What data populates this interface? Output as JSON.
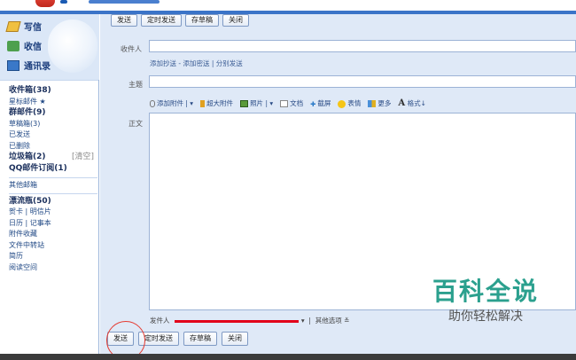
{
  "sidebar": {
    "compose_label": "写信",
    "inbox_label": "收信",
    "contacts_label": "通讯录",
    "folders": [
      {
        "label": "收件箱(38)",
        "bold": true
      },
      {
        "label": "星标邮件 ★",
        "bold": false
      },
      {
        "label": "群邮件(9)",
        "bold": true
      },
      {
        "label": "草稿箱(3)",
        "bold": false
      },
      {
        "label": "已发送",
        "bold": false
      },
      {
        "label": "已删除",
        "bold": false
      },
      {
        "label": "垃圾箱(2)",
        "bold": true,
        "extra": "[清空]"
      },
      {
        "label": "QQ邮件订阅(1)",
        "bold": true
      },
      {
        "label": "其他邮箱",
        "bold": false
      },
      {
        "label": "漂流瓶(50)",
        "bold": true
      },
      {
        "label": "贺卡 | 明信片",
        "bold": false
      },
      {
        "label": "日历 | 记事本",
        "bold": false
      },
      {
        "label": "附件收藏",
        "bold": false
      },
      {
        "label": "文件中转站",
        "bold": false
      },
      {
        "label": "简历",
        "bold": false
      },
      {
        "label": "阅读空间",
        "bold": false
      }
    ]
  },
  "toolbar_top": [
    "发送",
    "定时发送",
    "存草稿",
    "关闭"
  ],
  "compose": {
    "to_label": "收件人",
    "cc_links": "添加抄送 - 添加密送 | 分别发送",
    "subject_label": "主题",
    "body_label": "正文",
    "attach": "添加附件",
    "big_attach": "超大附件",
    "photo": "照片",
    "doc": "文档",
    "screenshot": "截屏",
    "emoji": "表情",
    "more": "更多",
    "format": "格式",
    "sender_label": "发件人",
    "other_options": "其他选项"
  },
  "toolbar_bottom": [
    "发送",
    "定时发送",
    "存草稿",
    "关闭"
  ],
  "watermark": {
    "line1": "百科全说",
    "line2": "助你轻松解决"
  }
}
